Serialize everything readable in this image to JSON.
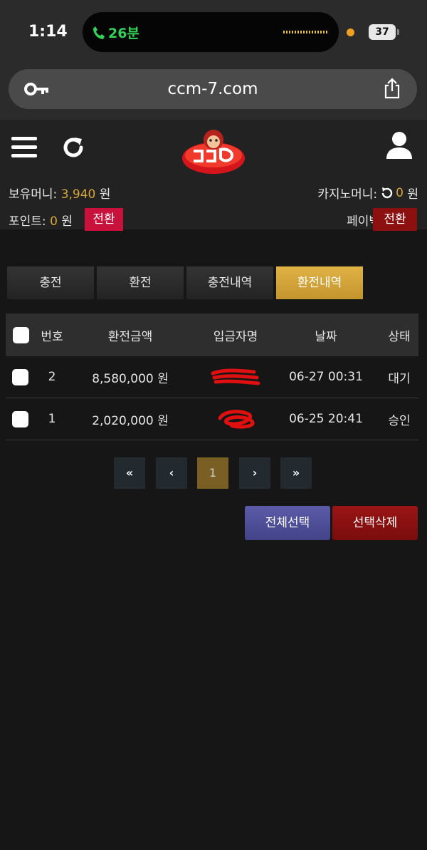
{
  "status_bar": {
    "time": "1:14",
    "call_duration": "26분",
    "battery": "37"
  },
  "browser": {
    "url": "ccm-7.com"
  },
  "balance": {
    "money_label": "보유머니:",
    "money_value": "3,940",
    "money_unit": "원",
    "casino_label": "카지노머니:",
    "casino_value": "0",
    "casino_unit": "원",
    "point_label": "포인트:",
    "point_value": "0",
    "point_unit": "원",
    "point_convert": "전환",
    "payback_label": "페이백",
    "payback_convert": "전환"
  },
  "tabs": [
    {
      "label": "충전",
      "active": false
    },
    {
      "label": "환전",
      "active": false
    },
    {
      "label": "충전내역",
      "active": false
    },
    {
      "label": "환전내역",
      "active": true
    }
  ],
  "table": {
    "headers": [
      "번호",
      "환전금액",
      "입금자명",
      "날짜",
      "상태"
    ],
    "rows": [
      {
        "num": "2",
        "amount": "8,580,000 원",
        "date": "06-27 00:31",
        "status": "대기"
      },
      {
        "num": "1",
        "amount": "2,020,000 원",
        "date": "06-25 20:41",
        "status": "승인"
      }
    ]
  },
  "pagination": {
    "first": "«",
    "prev": "‹",
    "current": "1",
    "next": "›",
    "last": "»"
  },
  "actions": {
    "select_all": "전체선택",
    "delete_selected": "선택삭제"
  },
  "colors": {
    "accent_gold": "#d5a63a",
    "active_tab": "#d4a53c",
    "convert_pink": "#c8123c",
    "convert_red": "#8c1010",
    "select_all": "#4f4f9a",
    "delete": "#8a1010"
  }
}
